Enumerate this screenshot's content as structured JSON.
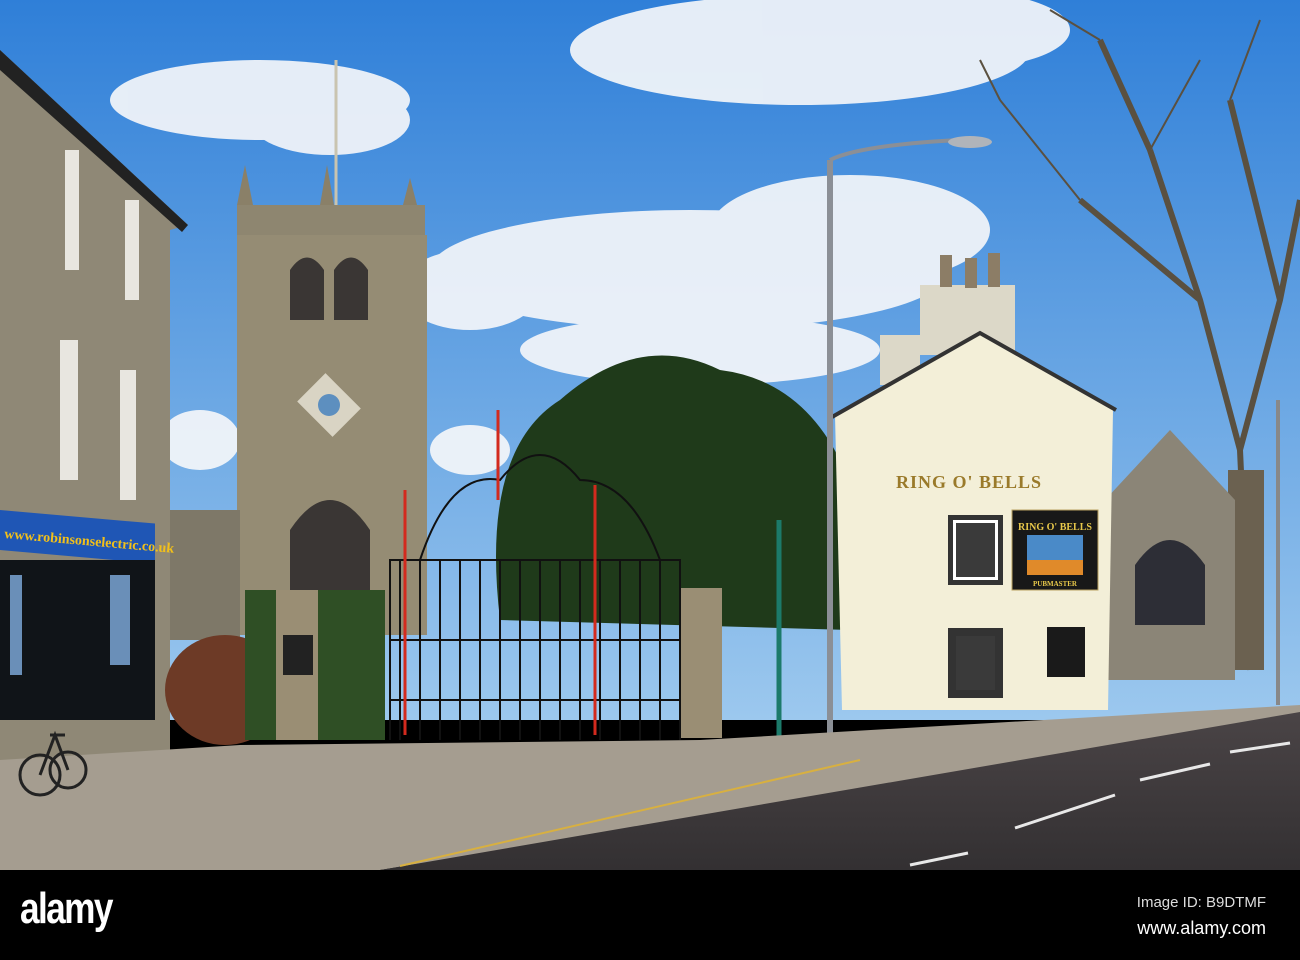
{
  "photo": {
    "shop_sign": "www.robinsonselectric.co.uk",
    "pub_name": "RING O' BELLS",
    "pub_sign_title": "RING O' BELLS",
    "pub_sign_subtitle": "PUBMASTER",
    "colors": {
      "sky_top": "#2f7fd8",
      "sky_bottom": "#8cc0ec",
      "stone": "#8d8570",
      "pub_wall": "#f3efd8",
      "road": "#3e3a3c",
      "shop_sign": "#1f56b5",
      "sign_text": "#f2c01a"
    }
  },
  "watermark": {
    "logo": "alamy",
    "image_id": "Image ID: B9DTMF",
    "site": "www.alamy.com"
  }
}
